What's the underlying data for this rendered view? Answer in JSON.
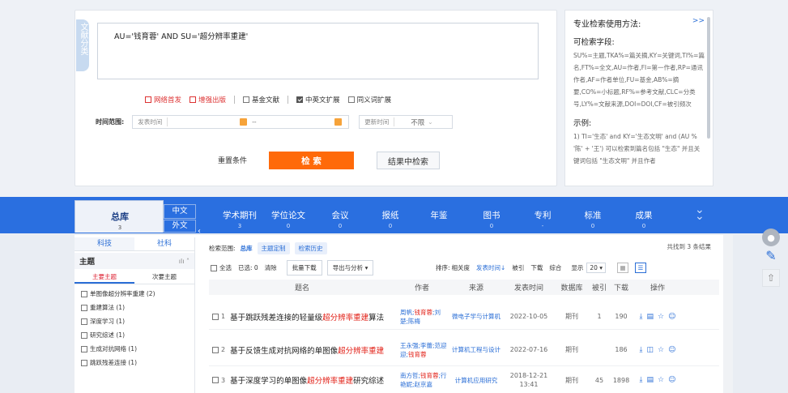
{
  "search": {
    "side_tag": "文献分类",
    "expression": "AU='钱育蓉' AND SU='超分辨率重建'",
    "options": [
      {
        "label": "网络首发",
        "checked": false,
        "red": true
      },
      {
        "label": "增强出版",
        "checked": false,
        "red": true
      },
      {
        "label": "基金文献",
        "checked": false,
        "red": false
      },
      {
        "label": "中英文扩展",
        "checked": true,
        "red": false
      },
      {
        "label": "同义词扩展",
        "checked": false,
        "red": false
      }
    ],
    "time_label": "时间范围:",
    "publish_time": "发表时间",
    "tilde": "--",
    "update_time": "更新时间",
    "unlimited": "不限",
    "reset": "重置条件",
    "search_btn": "检 索",
    "in_result": "结果中检索"
  },
  "help": {
    "title": "专业检索使用方法:",
    "more": ">>",
    "fields_title": "可检索字段:",
    "fields_text": "SU%=主题,TKA%=篇关摘,KY=关键词,TI%=篇名,FT%=全文,AU=作者,FI=第一作者,RP=通讯作者,AF=作者单位,FU=基金,AB%=摘要,CO%=小标题,RF%=参考文献,CLC=分类号,LY%=文献来源,DOI=DOI,CF=被引频次",
    "example_title": "示例:",
    "example_text": "1) TI='生态' and KY='生态文明' and (AU % '陈' + '王') 可以检索到篇名包括 \"生态\" 并且关键词包括 \"生态文明\" 并且作者"
  },
  "nav": {
    "total": {
      "label": "总库",
      "count": "3"
    },
    "zh": "中文",
    "wai": "外文",
    "items": [
      {
        "label": "学术期刊",
        "count": "3"
      },
      {
        "label": "学位论文",
        "count": "0"
      },
      {
        "label": "会议",
        "count": "0"
      },
      {
        "label": "报纸",
        "count": "0"
      },
      {
        "label": "年鉴",
        "count": ""
      },
      {
        "label": "图书",
        "count": "0"
      },
      {
        "label": "专利",
        "count": "-"
      },
      {
        "label": "标准",
        "count": "0"
      },
      {
        "label": "成果",
        "count": "0"
      }
    ]
  },
  "sidebar": {
    "tab1": "科技",
    "tab2": "社科",
    "section": "主题",
    "sub1": "主要主题",
    "sub2": "次要主题",
    "topics": [
      "单图像超分辨率重建 (2)",
      "重建算法 (1)",
      "深度学习 (1)",
      "研究综述 (1)",
      "生成对抗网络 (1)",
      "跳跃残差连接 (1)"
    ]
  },
  "results": {
    "scope_label": "检索范围:",
    "scope_value": "总库",
    "chip1": "主题定制",
    "chip2": "检索历史",
    "found": "共找到 3 条结果",
    "select_all": "全选",
    "selected": "已选: 0",
    "clear": "清除",
    "batch": "批量下载",
    "export": "导出与分析 ▾",
    "sort_label": "排序:",
    "sort_rel": "相关度",
    "sort_time": "发表时间↓",
    "sort_cite": "被引",
    "sort_dl": "下载",
    "sort_all": "综合",
    "show_label": "显示",
    "show_num": "20 ▾",
    "headers": [
      "题名",
      "作者",
      "来源",
      "发表时间",
      "数据库",
      "被引",
      "下载",
      "操作"
    ],
    "rows": [
      {
        "num": "1",
        "pre": "基于跳跃残差连接的轻量级",
        "hl": "超分辨率重建",
        "post": "算法",
        "author1": "周帆;",
        "author_hl": "钱育蓉",
        "author2": ";刘楚;陈梅",
        "source": "微电子学与计算机",
        "date": "2022-10-05",
        "db": "期刊",
        "cite": "1",
        "dl": "190"
      },
      {
        "num": "2",
        "pre": "基于反馈生成对抗网络的单图像",
        "hl": "超分辨率重建",
        "post": "",
        "author1": "王永强;李蕾;范迎迎;",
        "author_hl": "钱育蓉",
        "author2": "",
        "source": "计算机工程与设计",
        "date": "2022-07-16",
        "db": "期刊",
        "cite": "",
        "dl": "186"
      },
      {
        "num": "3",
        "pre": "基于深度学习的单图像",
        "hl": "超分辨率重建",
        "post": "研究综述",
        "author1": "南方哲;",
        "author_hl": "钱育蓉",
        "author2": ";行艳妮;赵京嘉",
        "source": "计算机应用研究",
        "date": "2018-12-21 13:41",
        "db": "期刊",
        "cite": "45",
        "dl": "1898"
      }
    ]
  }
}
